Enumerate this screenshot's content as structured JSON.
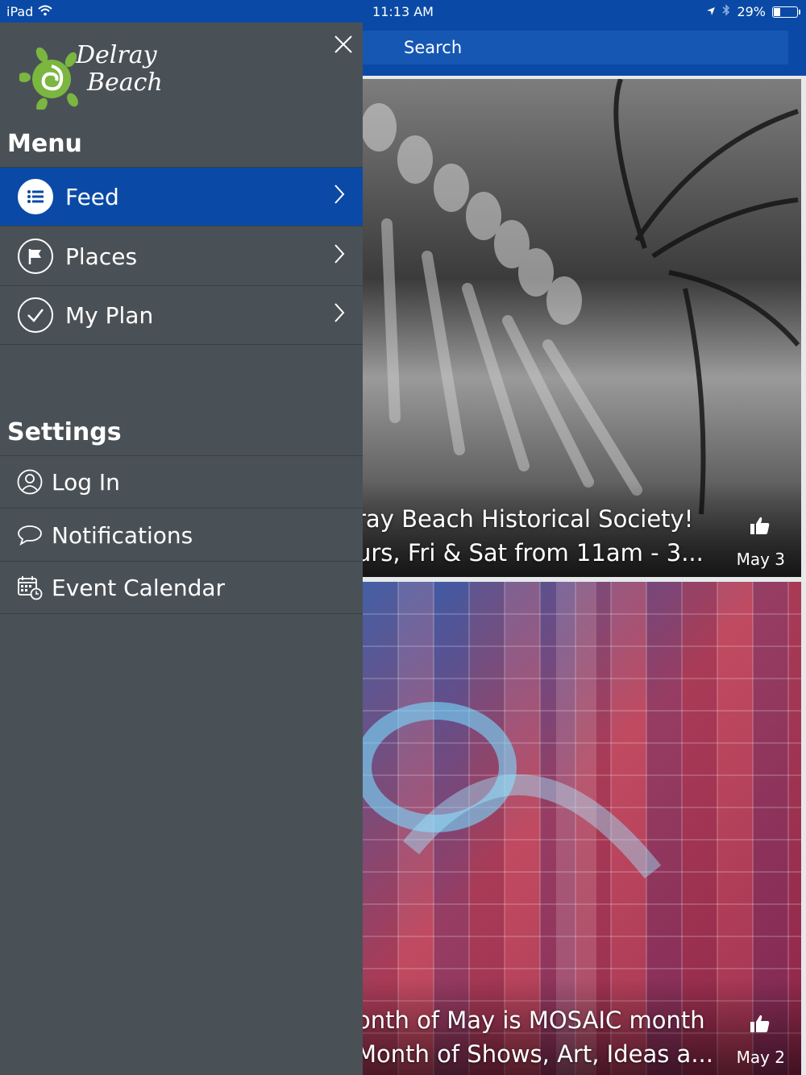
{
  "status_bar": {
    "device": "iPad",
    "time": "11:13 AM",
    "battery": "29%",
    "battery_level": 0.29
  },
  "search": {
    "label": "Search"
  },
  "drawer": {
    "logo_line1": "Delray",
    "logo_line2": "Beach",
    "menu_heading": "Menu",
    "menu_items": [
      {
        "label": "Feed",
        "icon": "list-icon",
        "active": true
      },
      {
        "label": "Places",
        "icon": "flag-icon",
        "active": false
      },
      {
        "label": "My Plan",
        "icon": "checkmark-icon",
        "active": false
      }
    ],
    "settings_heading": "Settings",
    "settings_items": [
      {
        "label": "Log In",
        "icon": "user-icon"
      },
      {
        "label": "Notifications",
        "icon": "speech-bubble-icon"
      },
      {
        "label": "Event Calendar",
        "icon": "calendar-icon"
      }
    ]
  },
  "feed": {
    "cards": [
      {
        "line1": "ray Beach Historical Society!",
        "line2": "urs, Fri & Sat from 11am - 3...",
        "date": "May 3"
      },
      {
        "line1": "onth of May is MOSAIC month",
        "line2": "Month of Shows, Art, Ideas a...",
        "date": "May 2"
      }
    ]
  }
}
